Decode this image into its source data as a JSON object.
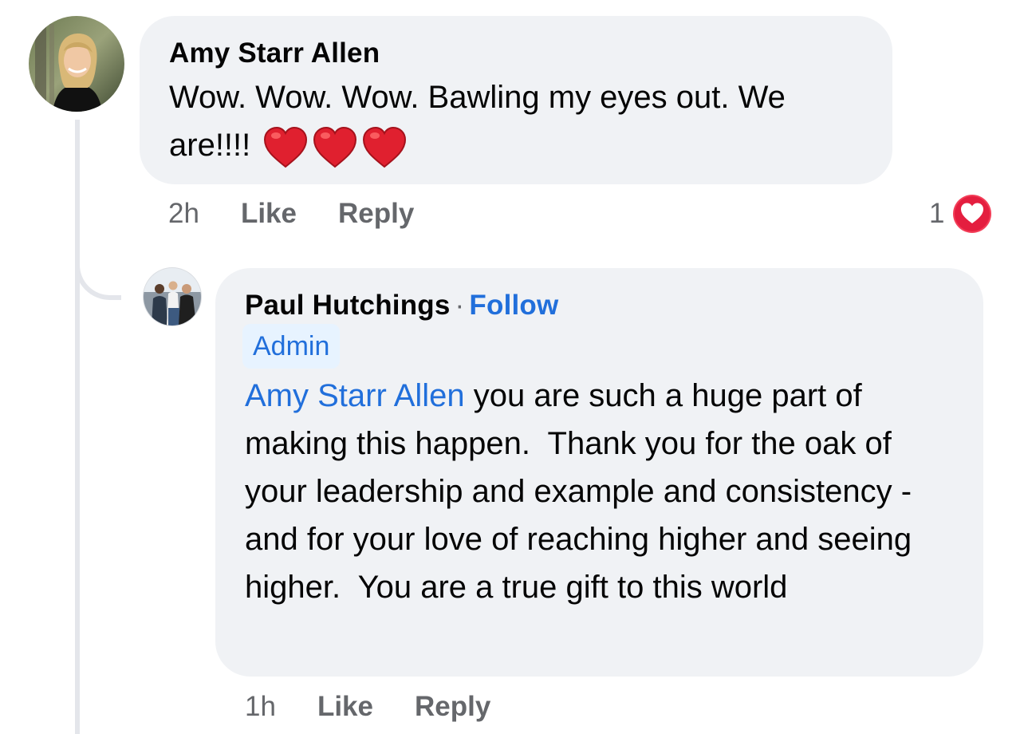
{
  "comments": [
    {
      "author": "Amy Starr Allen",
      "text": "Wow. Wow. Wow. Bawling my eyes out. We are!!!!",
      "emojis": [
        "red-heart-emoji",
        "red-heart-emoji",
        "red-heart-emoji"
      ],
      "timestamp": "2h",
      "like_label": "Like",
      "reply_label": "Reply",
      "reaction_count": "1",
      "reaction_type": "love-reaction-icon"
    }
  ],
  "replies": [
    {
      "author": "Paul Hutchings",
      "separator": "·",
      "follow_label": "Follow",
      "badge": "Admin",
      "mention": "Amy Starr Allen",
      "text": " you are such a huge part of making this happen.  Thank you for the oak of your leadership and example and consistency - and for your love of reaching higher and seeing higher.  You are a true gift to this world",
      "timestamp": "1h",
      "like_label": "Like",
      "reply_label": "Reply"
    }
  ],
  "colors": {
    "bubble": "#f0f2f5",
    "link": "#216fdb",
    "secondary_text": "#65676b",
    "badge_bg": "#e7f3ff",
    "reaction_red": "#e41e3f"
  }
}
